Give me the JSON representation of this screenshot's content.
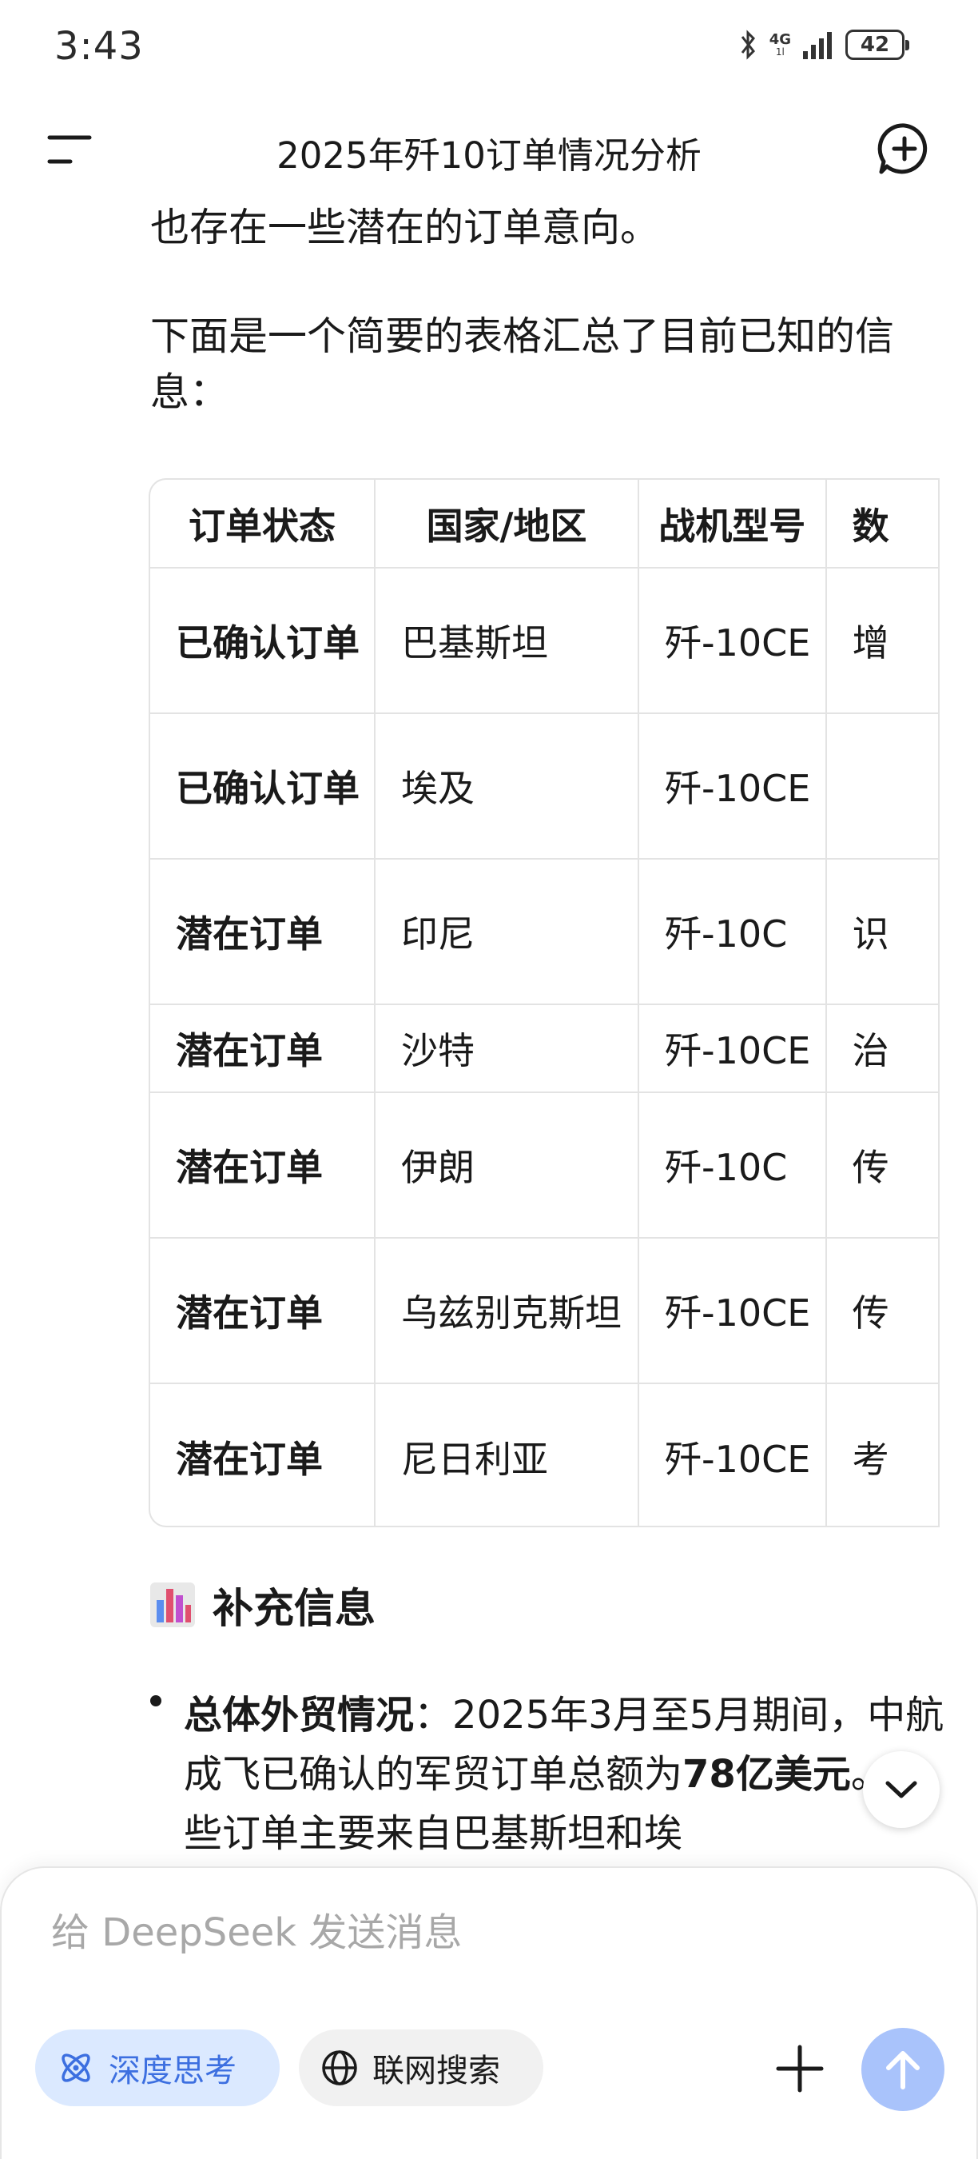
{
  "status_bar": {
    "time": "3:43",
    "network": "4G",
    "network_sub": "1l",
    "battery": "42"
  },
  "header": {
    "title": "2025年歼10订单情况分析"
  },
  "content": {
    "para1": "也存在一些潜在的订单意向。",
    "para2": "下面是一个简要的表格汇总了目前已知的信息："
  },
  "table": {
    "headers": [
      "订单状态",
      "国家/地区",
      "战机型号",
      "数"
    ],
    "rows": [
      {
        "status": "已确认订单",
        "country": "巴基斯坦",
        "model": "歼-10CE",
        "qty": "增"
      },
      {
        "status": "已确认订单",
        "country": "埃及",
        "model": "歼-10CE",
        "qty": ""
      },
      {
        "status": "潜在订单",
        "country": "印尼",
        "model": "歼-10C",
        "qty": "识"
      },
      {
        "status": "潜在订单",
        "country": "沙特",
        "model": "歼-10CE",
        "qty": "治"
      },
      {
        "status": "潜在订单",
        "country": "伊朗",
        "model": "歼-10C",
        "qty": "传"
      },
      {
        "status": "潜在订单",
        "country": "乌兹别克斯坦",
        "model": "歼-10CE",
        "qty": "传"
      },
      {
        "status": "潜在订单",
        "country": "尼日利亚",
        "model": "歼-10CE",
        "qty": "考"
      }
    ]
  },
  "supplement": {
    "title": "补充信息",
    "icon": "bar-chart-icon",
    "bullet_label": "总体外贸情况",
    "bullet_sep": "：",
    "bullet_text1": "2025年3月至5月期间，中航成飞已确认的军贸订单总额为",
    "bullet_amount": "78亿美元",
    "bullet_text2": "。这些订单主要来自巴基斯坦和埃"
  },
  "input": {
    "placeholder": "给 DeepSeek 发送消息",
    "deep_think_label": "深度思考",
    "web_search_label": "联网搜索"
  },
  "colors": {
    "accent": "#3c6fe0",
    "chip_bg": "#dbe9ff",
    "send_bg": "#a9c3fb"
  }
}
